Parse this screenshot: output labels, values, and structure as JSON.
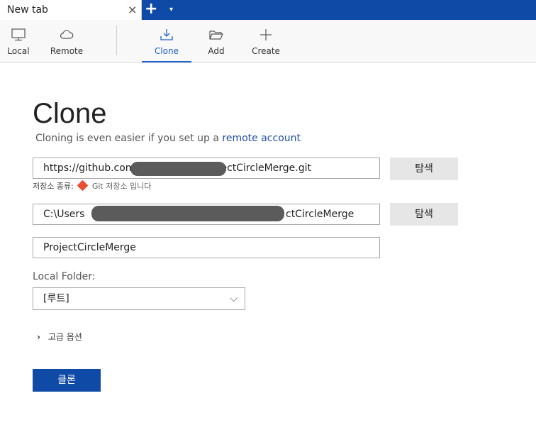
{
  "tabs": {
    "active_title": "New tab",
    "close_symbol": "×",
    "add_symbol": "+",
    "menu_symbol": "▾"
  },
  "toolbar": {
    "items": [
      {
        "label": "Local",
        "icon": "monitor-icon"
      },
      {
        "label": "Remote",
        "icon": "cloud-icon"
      },
      {
        "label": "Clone",
        "icon": "download-tray-icon",
        "active": true
      },
      {
        "label": "Add",
        "icon": "folder-open-icon"
      },
      {
        "label": "Create",
        "icon": "plus-icon"
      }
    ]
  },
  "clone": {
    "title": "Clone",
    "subtitle_prefix": "Cloning is even easier if you set up a",
    "subtitle_link": "remote account",
    "source_url": {
      "visible_start": "https://github.com",
      "visible_end": "ojectCircleMerge.git"
    },
    "repo_type_label": "저장소 종류:",
    "repo_type_value": "Git 저장소 입니다",
    "browse_label_1": "탐색",
    "dest_path": {
      "visible_start": "C:\\Users",
      "visible_end": "ctCircleMerge"
    },
    "browse_label_2": "탐색",
    "name_value": "ProjectCircleMerge",
    "local_folder_label": "Local Folder:",
    "local_folder_value": "[루트]",
    "advanced_label": "고급 옵션",
    "clone_button": "클론"
  },
  "colors": {
    "accent": "#0f4aa6",
    "active_tab_text": "#1d63c8",
    "link": "#1d4fa0",
    "git_icon": "#e94e31"
  }
}
